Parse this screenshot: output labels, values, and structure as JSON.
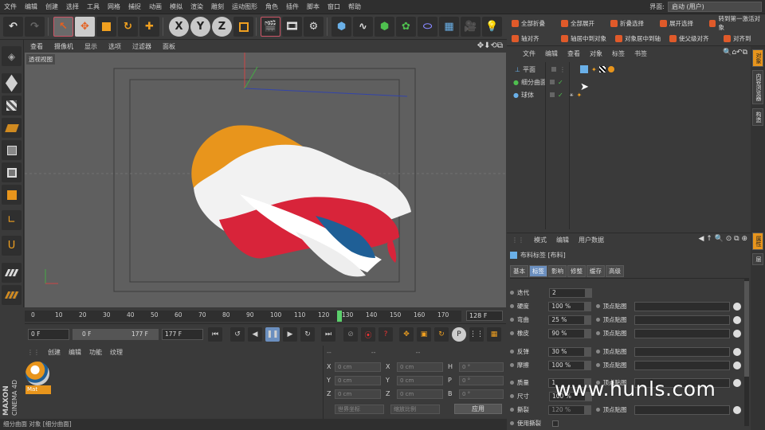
{
  "menu": {
    "items": [
      "文件",
      "编辑",
      "创建",
      "选择",
      "工具",
      "网格",
      "捕捉",
      "动画",
      "模拟",
      "渲染",
      "雕刻",
      "运动图形",
      "角色",
      "插件",
      "脚本",
      "窗口",
      "帮助"
    ]
  },
  "layout": {
    "label": "界面:",
    "value": "启动 (用户)"
  },
  "viewport": {
    "menu": [
      "查看",
      "摄像机",
      "显示",
      "选项",
      "过滤器",
      "面板"
    ],
    "label": "透视视图",
    "colors": {
      "orange": "#e8951c",
      "white": "#f2f2f2",
      "red": "#d8243a",
      "blue": "#1f5f96",
      "bg": "#5f5f5f"
    }
  },
  "timeline": {
    "ticks": [
      "0",
      "10",
      "20",
      "30",
      "40",
      "50",
      "60",
      "70",
      "80",
      "90",
      "100",
      "110",
      "120",
      "130",
      "140",
      "150",
      "160",
      "170"
    ],
    "end_box": "128 F",
    "current_frame": "128"
  },
  "transport": {
    "start": "0 F",
    "range_start": "0 F",
    "range_end": "177 F",
    "end": "177 F"
  },
  "material": {
    "menu": [
      "创建",
      "编辑",
      "功能",
      "纹理"
    ],
    "name": "Mat"
  },
  "coords": {
    "header": [
      "--",
      "--",
      "--"
    ],
    "rows": [
      {
        "a": "X",
        "av": "0 cm",
        "b": "X",
        "bv": "0 cm",
        "c": "H",
        "cv": "0 °"
      },
      {
        "a": "Y",
        "av": "0 cm",
        "b": "Y",
        "bv": "0 cm",
        "c": "P",
        "cv": "0 °"
      },
      {
        "a": "Z",
        "av": "0 cm",
        "b": "Z",
        "bv": "0 cm",
        "c": "B",
        "cv": "0 °"
      }
    ],
    "mode1": "世界坐标",
    "mode2": "缩放比例",
    "apply": "应用"
  },
  "status": "细分曲面 对象 [细分曲面]",
  "brand": {
    "top": "MAXON",
    "bottom": "CINEMA 4D"
  },
  "right_toolbar": {
    "row1": [
      "全部折叠",
      "全部展开",
      "折叠选择",
      "展开选择",
      "转到第一激活对象"
    ],
    "row2": [
      "轴对齐",
      "轴居中到对象",
      "对象居中到轴",
      "使父级对齐",
      "对齐到"
    ]
  },
  "objects": {
    "menu": [
      "文件",
      "编辑",
      "查看",
      "对象",
      "标签",
      "书签"
    ],
    "rows": [
      {
        "name": "平面"
      },
      {
        "name": "细分曲面"
      },
      {
        "name": "球体"
      }
    ]
  },
  "right_tabs": [
    "对象",
    "内容浏览器",
    "构造",
    "属性",
    "层"
  ],
  "attributes": {
    "menu": [
      "模式",
      "编辑",
      "用户数据"
    ],
    "title": "布料标签 [布料]",
    "tabs": [
      "基本",
      "标签",
      "影响",
      "修整",
      "缓存",
      "高级"
    ],
    "active_tab": "标签",
    "rows": [
      {
        "label": "迭代",
        "value": "2",
        "sub": "",
        "map": false
      },
      {
        "label": "硬度",
        "value": "100 %",
        "sub": "顶点贴图",
        "map": true
      },
      {
        "label": "弯曲",
        "value": "25 %",
        "sub": "顶点贴图",
        "map": true
      },
      {
        "label": "橡皮",
        "value": "90 %",
        "sub": "顶点贴图",
        "map": true
      },
      {
        "label": "反弹",
        "value": "30 %",
        "sub": "顶点贴图",
        "map": true
      },
      {
        "label": "摩擦",
        "value": "100 %",
        "sub": "顶点贴图",
        "map": true
      },
      {
        "label": "质量",
        "value": "1",
        "sub": "顶点贴图",
        "map": true
      },
      {
        "label": "尺寸",
        "value": "100 %",
        "sub": "",
        "map": false
      },
      {
        "label": "撕裂",
        "value": "120 %",
        "sub": "顶点贴图",
        "map": true
      },
      {
        "label": "使用撕裂",
        "value": "",
        "sub": "",
        "map": false
      }
    ]
  },
  "watermark": "www.hunls.com"
}
